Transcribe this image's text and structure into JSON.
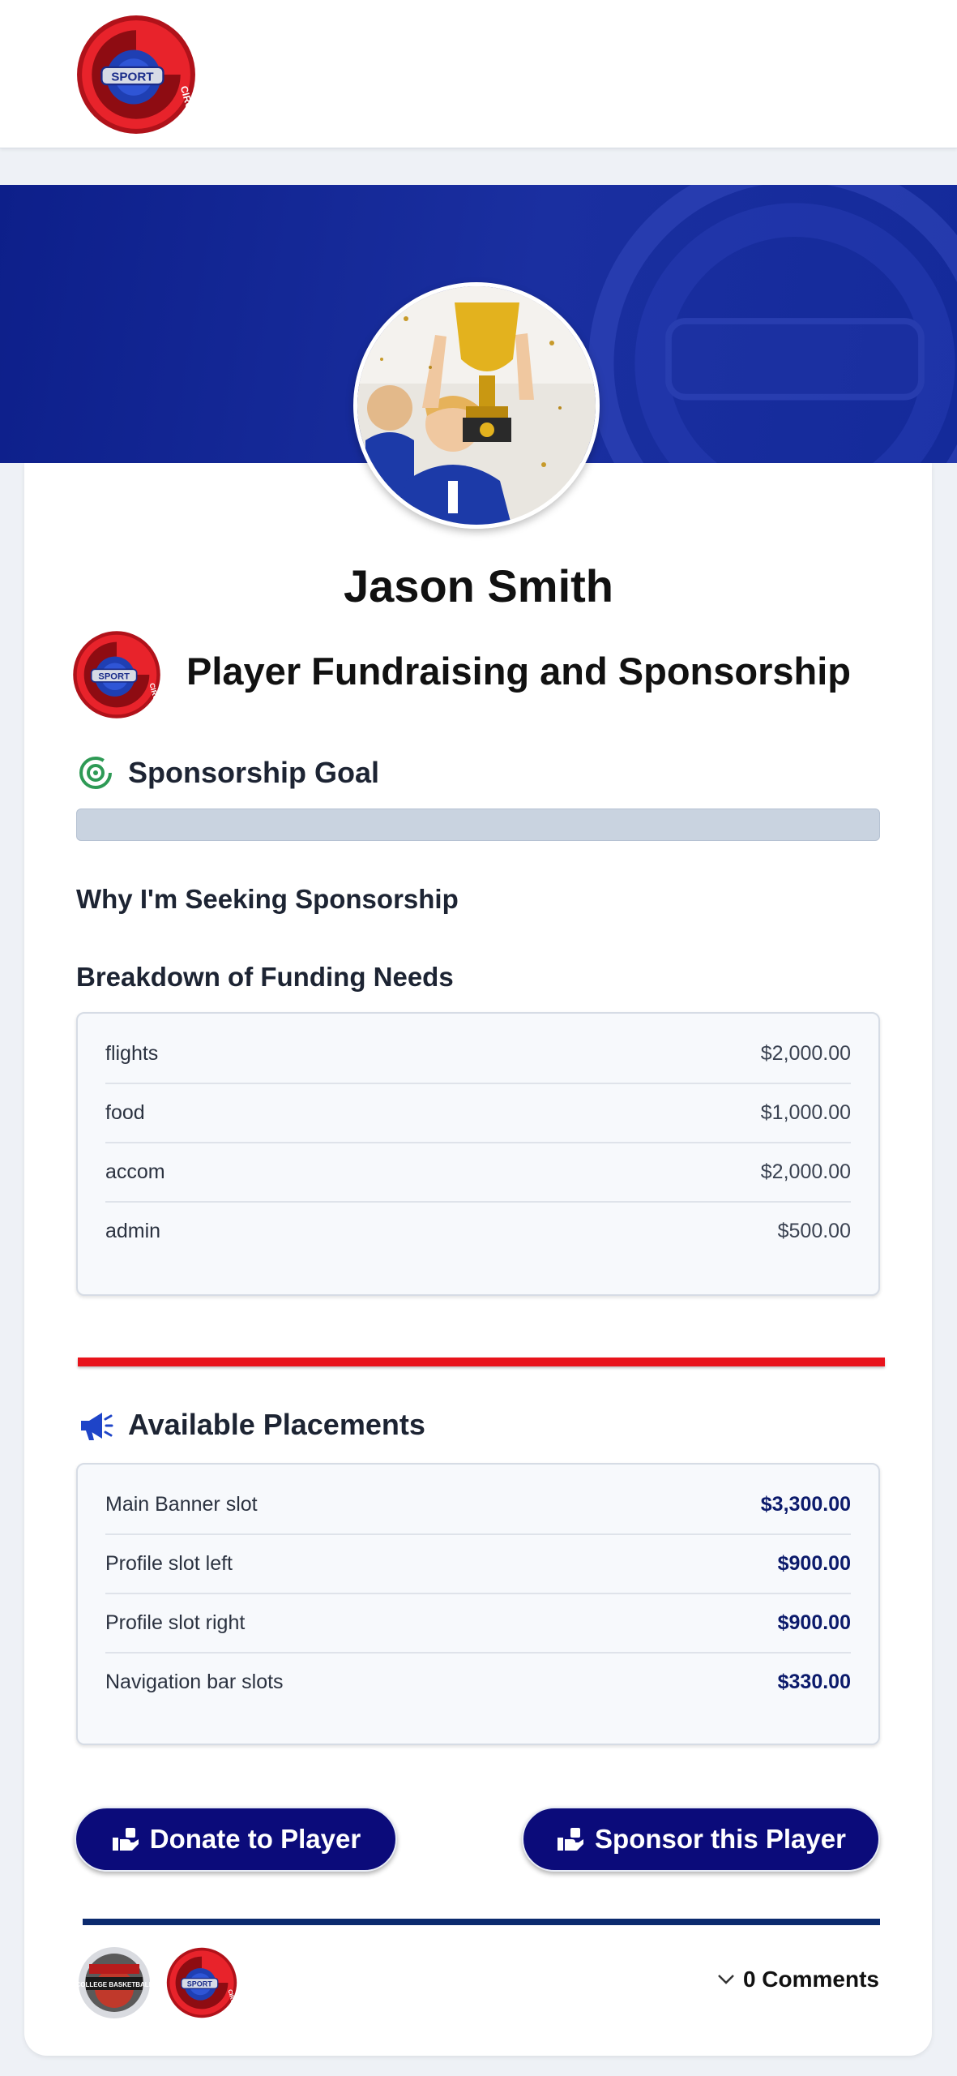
{
  "header": {
    "logo_icon": "sport-circle-logo"
  },
  "profile": {
    "name": "Jason Smith",
    "avatar_icon": "player-with-trophy-photo",
    "page_title": "Player Fundraising and Sponsorship"
  },
  "goal": {
    "title": "Sponsorship Goal",
    "icon": "target-icon",
    "progress_fraction": 0
  },
  "why_title": "Why I'm Seeking Sponsorship",
  "breakdown": {
    "title": "Breakdown of Funding Needs",
    "rows": [
      {
        "label": "flights",
        "amount": "$2,000.00"
      },
      {
        "label": "food",
        "amount": "$1,000.00"
      },
      {
        "label": "accom",
        "amount": "$2,000.00"
      },
      {
        "label": "admin",
        "amount": "$500.00"
      }
    ]
  },
  "placements": {
    "title": "Available Placements",
    "icon": "megaphone-icon",
    "rows": [
      {
        "label": "Main Banner slot",
        "amount": "$3,300.00"
      },
      {
        "label": "Profile slot left",
        "amount": "$900.00"
      },
      {
        "label": "Profile slot right",
        "amount": "$900.00"
      },
      {
        "label": "Navigation bar slots",
        "amount": "$330.00"
      }
    ]
  },
  "buttons": {
    "donate_label": "Donate to Player",
    "sponsor_label": "Sponsor this Player"
  },
  "footer": {
    "badge1_text": "COLLEGE BASKETBALL",
    "comments_label": "0 Comments"
  },
  "colors": {
    "brand_navy": "#0b0b7a",
    "banner_blue": "#1a2fa0",
    "accent_red": "#e8131b",
    "goal_green": "#2e9a55"
  }
}
